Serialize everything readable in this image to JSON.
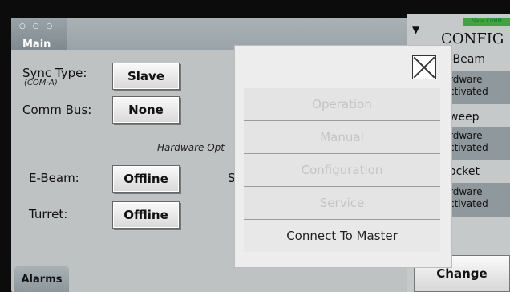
{
  "tab": {
    "dots": "○ ○ ○",
    "label": "Main"
  },
  "sync": {
    "label": "Sync Type:",
    "sublabel": "(COM-A)",
    "value": "Slave"
  },
  "comm": {
    "label": "Comm Bus:",
    "value": "None"
  },
  "hardware": {
    "title": "Hardware Opt",
    "fragment": "S"
  },
  "ebeam": {
    "label": "E-Beam:",
    "value": "Offline"
  },
  "turret": {
    "label": "Turret:",
    "value": "Offline"
  },
  "alarms_label": "Alarms",
  "config": {
    "badge": "Slave COMM",
    "title": "CONFIG",
    "sections": [
      {
        "head": "-Beam",
        "line1": "rdware",
        "line2": "ctivated"
      },
      {
        "head": "weep",
        "line1": "rdware",
        "line2": "ctivated"
      },
      {
        "head": "ocket",
        "line1": "rdware",
        "line2": "ctivated"
      }
    ],
    "change_label": "Change"
  },
  "menu": [
    {
      "label": "Operation"
    },
    {
      "label": "Manual"
    },
    {
      "label": "Configuration"
    },
    {
      "label": "Service"
    },
    {
      "label": "Connect To Master"
    }
  ],
  "colors": {
    "badge": "#3fa53f",
    "panel": "#bfc2c2"
  }
}
